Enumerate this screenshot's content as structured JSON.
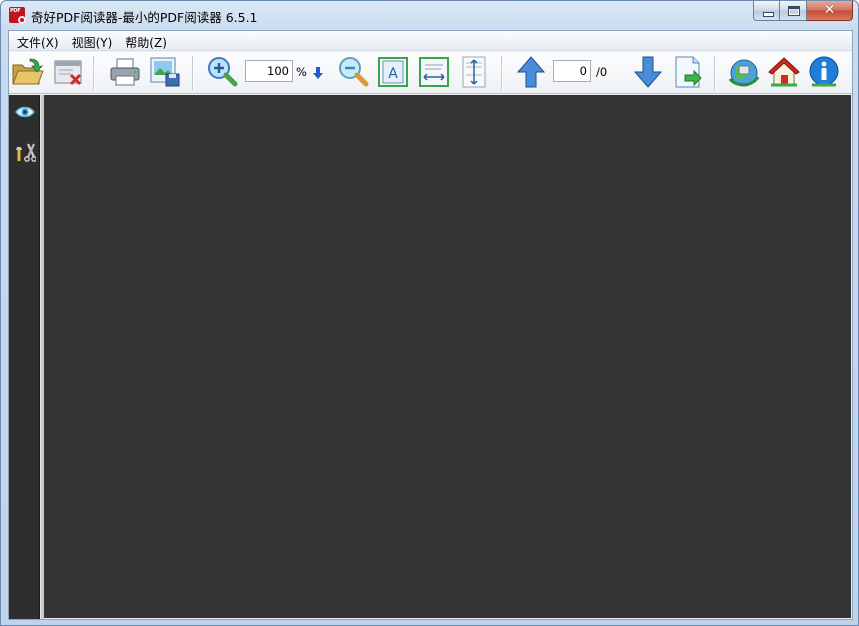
{
  "window": {
    "title": "奇好PDF阅读器-最小的PDF阅读器 6.5.1",
    "app_icon_text": "PDF"
  },
  "menu": {
    "items": [
      {
        "label": "文件(X)"
      },
      {
        "label": "视图(Y)"
      },
      {
        "label": "帮助(Z)"
      }
    ]
  },
  "toolbar": {
    "zoom_value": "100",
    "zoom_unit": "%",
    "page_value": "0",
    "page_total": "/0",
    "icons": [
      "open-folder-icon",
      "close-document-icon",
      "print-icon",
      "save-image-icon",
      "zoom-in-icon",
      "zoom-dropdown-arrow-icon",
      "zoom-out-icon",
      "fit-actual-size-icon",
      "fit-width-icon",
      "fit-height-icon",
      "previous-page-icon",
      "next-page-icon",
      "export-page-icon",
      "web-update-icon",
      "home-icon",
      "about-info-icon"
    ]
  },
  "sidebar": {
    "icons": [
      "eye-view-icon",
      "tools-icon"
    ]
  },
  "colors": {
    "viewer_background": "#333333",
    "sidebar_background": "#2e2e2e",
    "title_bar": "#c9dbee",
    "close_button": "#c44b36"
  }
}
